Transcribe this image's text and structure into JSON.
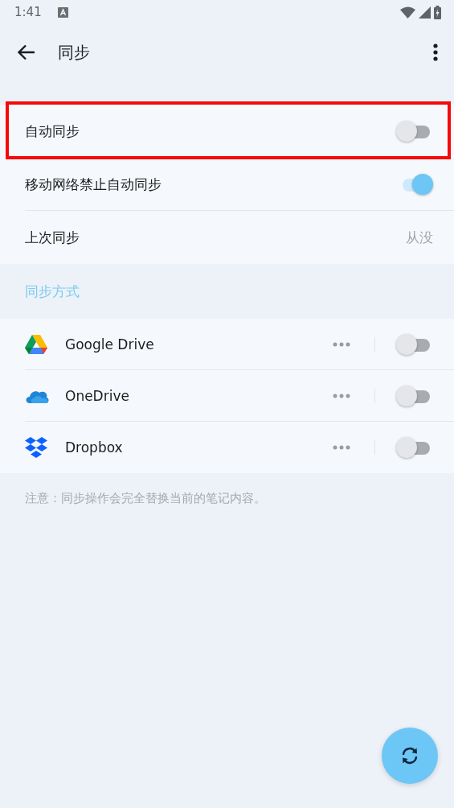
{
  "status_bar": {
    "time": "1:41"
  },
  "app_bar": {
    "title": "同步"
  },
  "settings": [
    {
      "kind": "switch",
      "label": "自动同步",
      "on": false,
      "highlighted": true
    },
    {
      "kind": "switch",
      "label": "移动网络禁止自动同步",
      "on": true,
      "highlighted": false
    },
    {
      "kind": "value",
      "label": "上次同步",
      "value": "从没",
      "highlighted": false
    }
  ],
  "methods_section": {
    "title": "同步方式",
    "providers": [
      {
        "name": "Google Drive",
        "on": false
      },
      {
        "name": "OneDrive",
        "on": false
      },
      {
        "name": "Dropbox",
        "on": false
      }
    ]
  },
  "note": "注意：同步操作会完全替换当前的笔记内容。"
}
